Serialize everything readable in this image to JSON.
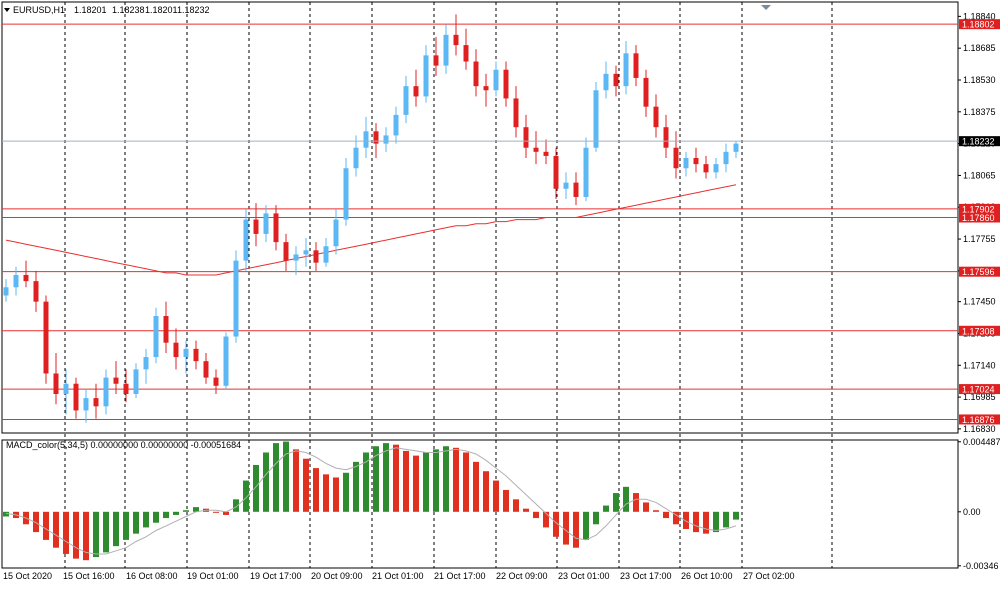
{
  "chart_data": {
    "type": "candlestick",
    "symbol_label": "EURUSD,H1",
    "ohlc_readout": [
      "1.18201",
      "1.18238",
      "1.18201",
      "1.18232"
    ],
    "current_price": "1.18232",
    "y_ticks": [
      "1.18840",
      "1.18685",
      "1.18530",
      "1.18375",
      "1.18220",
      "1.18065",
      "1.17910",
      "1.17755",
      "1.17600",
      "1.17450",
      "1.17295",
      "1.17140",
      "1.16985",
      "1.16830"
    ],
    "ylim": [
      1.1681,
      1.1891
    ],
    "grid": "vertical dashed at session boundaries",
    "x_ticks": [
      "15 Oct 2020",
      "15 Oct 16:00",
      "16 Oct 08:00",
      "19 Oct 01:00",
      "19 Oct 17:00",
      "20 Oct 09:00",
      "21 Oct 01:00",
      "21 Oct 17:00",
      "22 Oct 09:00",
      "23 Oct 01:00",
      "23 Oct 17:00",
      "26 Oct 10:00",
      "27 Oct 02:00"
    ],
    "horizontal_levels": [
      "1.18802",
      "1.17902",
      "1.17860",
      "1.17596",
      "1.17308",
      "1.17024",
      "1.16876"
    ],
    "candles": [
      [
        1.1748,
        1.1756,
        1.1745,
        1.1752
      ],
      [
        1.1752,
        1.1762,
        1.1748,
        1.1758
      ],
      [
        1.1758,
        1.1765,
        1.1752,
        1.1755
      ],
      [
        1.1755,
        1.176,
        1.174,
        1.1745
      ],
      [
        1.1745,
        1.1748,
        1.1705,
        1.171
      ],
      [
        1.171,
        1.172,
        1.1695,
        1.17
      ],
      [
        1.17,
        1.1712,
        1.169,
        1.1705
      ],
      [
        1.1705,
        1.1708,
        1.1688,
        1.1692
      ],
      [
        1.1692,
        1.1702,
        1.1686,
        1.1698
      ],
      [
        1.1698,
        1.1705,
        1.1688,
        1.1694
      ],
      [
        1.1694,
        1.1712,
        1.169,
        1.1708
      ],
      [
        1.1708,
        1.1716,
        1.17,
        1.1705
      ],
      [
        1.1705,
        1.1712,
        1.1696,
        1.17
      ],
      [
        1.17,
        1.1715,
        1.1698,
        1.1712
      ],
      [
        1.1712,
        1.1722,
        1.1705,
        1.1718
      ],
      [
        1.1718,
        1.1742,
        1.1715,
        1.1738
      ],
      [
        1.1738,
        1.1745,
        1.172,
        1.1725
      ],
      [
        1.1725,
        1.1732,
        1.1712,
        1.1718
      ],
      [
        1.1718,
        1.1726,
        1.171,
        1.1722
      ],
      [
        1.1722,
        1.1726,
        1.1712,
        1.1716
      ],
      [
        1.1716,
        1.172,
        1.1705,
        1.1708
      ],
      [
        1.1708,
        1.1712,
        1.17,
        1.1704
      ],
      [
        1.1704,
        1.173,
        1.1702,
        1.1728
      ],
      [
        1.1728,
        1.177,
        1.1725,
        1.1765
      ],
      [
        1.1765,
        1.179,
        1.176,
        1.1785
      ],
      [
        1.1785,
        1.1793,
        1.1772,
        1.1778
      ],
      [
        1.1778,
        1.1792,
        1.1774,
        1.1788
      ],
      [
        1.1788,
        1.1792,
        1.177,
        1.1774
      ],
      [
        1.1774,
        1.1778,
        1.176,
        1.1765
      ],
      [
        1.1765,
        1.1772,
        1.1758,
        1.1768
      ],
      [
        1.1768,
        1.1776,
        1.1762,
        1.177
      ],
      [
        1.177,
        1.1774,
        1.176,
        1.1764
      ],
      [
        1.1764,
        1.1776,
        1.1762,
        1.1772
      ],
      [
        1.1772,
        1.179,
        1.1768,
        1.1785
      ],
      [
        1.1785,
        1.1815,
        1.1782,
        1.181
      ],
      [
        1.181,
        1.1826,
        1.1806,
        1.182
      ],
      [
        1.182,
        1.1835,
        1.1815,
        1.1828
      ],
      [
        1.1828,
        1.1832,
        1.1815,
        1.1822
      ],
      [
        1.1822,
        1.183,
        1.1818,
        1.1826
      ],
      [
        1.1826,
        1.184,
        1.1822,
        1.1836
      ],
      [
        1.1836,
        1.1855,
        1.1832,
        1.185
      ],
      [
        1.185,
        1.1858,
        1.184,
        1.1845
      ],
      [
        1.1845,
        1.187,
        1.1842,
        1.1865
      ],
      [
        1.1865,
        1.1874,
        1.1855,
        1.186
      ],
      [
        1.186,
        1.188,
        1.1856,
        1.1875
      ],
      [
        1.1875,
        1.1885,
        1.1865,
        1.187
      ],
      [
        1.187,
        1.1878,
        1.1858,
        1.1862
      ],
      [
        1.1862,
        1.1868,
        1.1845,
        1.185
      ],
      [
        1.185,
        1.1856,
        1.184,
        1.1848
      ],
      [
        1.1848,
        1.1862,
        1.1845,
        1.1858
      ],
      [
        1.1858,
        1.1862,
        1.184,
        1.1844
      ],
      [
        1.1844,
        1.185,
        1.1825,
        1.183
      ],
      [
        1.183,
        1.1836,
        1.1815,
        1.182
      ],
      [
        1.182,
        1.1828,
        1.1812,
        1.1818
      ],
      [
        1.1818,
        1.1824,
        1.1812,
        1.1816
      ],
      [
        1.1816,
        1.182,
        1.1795,
        1.18
      ],
      [
        1.18,
        1.1808,
        1.1795,
        1.1803
      ],
      [
        1.1803,
        1.1808,
        1.1792,
        1.1796
      ],
      [
        1.1796,
        1.1825,
        1.1794,
        1.182
      ],
      [
        1.182,
        1.1852,
        1.1818,
        1.1848
      ],
      [
        1.1848,
        1.1862,
        1.1844,
        1.1856
      ],
      [
        1.1856,
        1.186,
        1.1845,
        1.185
      ],
      [
        1.185,
        1.1872,
        1.1846,
        1.1866
      ],
      [
        1.1866,
        1.187,
        1.185,
        1.1854
      ],
      [
        1.1854,
        1.1858,
        1.1835,
        1.184
      ],
      [
        1.184,
        1.1846,
        1.1825,
        1.183
      ],
      [
        1.183,
        1.1836,
        1.1815,
        1.182
      ],
      [
        1.182,
        1.1828,
        1.1805,
        1.181
      ],
      [
        1.181,
        1.1818,
        1.1806,
        1.1815
      ],
      [
        1.1815,
        1.182,
        1.1808,
        1.1812
      ],
      [
        1.1812,
        1.1816,
        1.1805,
        1.1808
      ],
      [
        1.1808,
        1.1815,
        1.1805,
        1.1812
      ],
      [
        1.1812,
        1.1822,
        1.1808,
        1.1818
      ],
      [
        1.1818,
        1.1823,
        1.1815,
        1.1822
      ]
    ],
    "ma_line": [
      1.1775,
      1.1774,
      1.1773,
      1.1772,
      1.1771,
      1.177,
      1.1769,
      1.1768,
      1.1767,
      1.1766,
      1.1765,
      1.1764,
      1.1763,
      1.1762,
      1.1761,
      1.176,
      1.1759,
      1.1759,
      1.1758,
      1.1758,
      1.1758,
      1.1758,
      1.1759,
      1.176,
      1.1761,
      1.1762,
      1.1763,
      1.1764,
      1.1765,
      1.1766,
      1.1767,
      1.1768,
      1.1769,
      1.177,
      1.1771,
      1.1772,
      1.1773,
      1.1774,
      1.1775,
      1.1776,
      1.1777,
      1.1778,
      1.1779,
      1.178,
      1.1781,
      1.1782,
      1.1782,
      1.1783,
      1.1783,
      1.1784,
      1.1784,
      1.1785,
      1.1785,
      1.1785,
      1.1786,
      1.1786,
      1.1786,
      1.1786,
      1.1787,
      1.1788,
      1.1789,
      1.179,
      1.1791,
      1.1792,
      1.1793,
      1.1794,
      1.1795,
      1.1796,
      1.1797,
      1.1798,
      1.1799,
      1.18,
      1.1801,
      1.1802
    ],
    "macd": {
      "label": "MACD_color(5,34,5) 0.00000000 0.00000000 -0.00051684",
      "y_ticks": [
        "0.004487",
        "0.00",
        "-0.00346"
      ],
      "ylim": [
        -0.0036,
        0.0046
      ],
      "histogram": [
        -0.0003,
        -0.0004,
        -0.0008,
        -0.0013,
        -0.0018,
        -0.0023,
        -0.0027,
        -0.003,
        -0.0031,
        -0.0029,
        -0.0026,
        -0.0022,
        -0.0018,
        -0.0014,
        -0.001,
        -0.0007,
        -0.0004,
        -0.0002,
        0.0001,
        0.0003,
        0.0002,
        0.0,
        -0.0002,
        0.0008,
        0.002,
        0.003,
        0.0038,
        0.0044,
        0.0045,
        0.004,
        0.0034,
        0.0028,
        0.0024,
        0.0022,
        0.0025,
        0.0032,
        0.0038,
        0.0042,
        0.0044,
        0.0043,
        0.0039,
        0.0036,
        0.0038,
        0.004,
        0.0042,
        0.0041,
        0.0038,
        0.0032,
        0.0026,
        0.002,
        0.0014,
        0.0008,
        0.0002,
        -0.0004,
        -0.001,
        -0.0016,
        -0.0021,
        -0.0023,
        -0.0018,
        -0.0008,
        0.0004,
        0.0012,
        0.0016,
        0.0012,
        0.0006,
        0.0001,
        -0.0004,
        -0.0008,
        -0.0011,
        -0.0013,
        -0.0014,
        -0.0013,
        -0.001,
        -0.0005
      ],
      "signal_line": [
        -0.0001,
        -0.0002,
        -0.0004,
        -0.0007,
        -0.0011,
        -0.0015,
        -0.0019,
        -0.0023,
        -0.0026,
        -0.0027,
        -0.0027,
        -0.0025,
        -0.0023,
        -0.0019,
        -0.0016,
        -0.0012,
        -0.0009,
        -0.0006,
        -0.0003,
        0.0,
        0.0001,
        0.0001,
        0.0,
        0.0003,
        0.0009,
        0.0016,
        0.0024,
        0.0031,
        0.0037,
        0.0039,
        0.0038,
        0.0035,
        0.0031,
        0.0028,
        0.0027,
        0.0029,
        0.0032,
        0.0036,
        0.0039,
        0.0041,
        0.004,
        0.0039,
        0.0038,
        0.0038,
        0.0039,
        0.004,
        0.0039,
        0.0037,
        0.0033,
        0.0028,
        0.0023,
        0.0017,
        0.0011,
        0.0005,
        -0.0001,
        -0.0007,
        -0.0012,
        -0.0017,
        -0.0018,
        -0.0015,
        -0.0009,
        -0.0002,
        0.0005,
        0.0008,
        0.0008,
        0.0006,
        0.0002,
        -0.0002,
        -0.0006,
        -0.0009,
        -0.0011,
        -0.0012,
        -0.0011,
        -0.0009
      ]
    },
    "colors": {
      "bull": "#5bb8f5",
      "bear": "#e02020",
      "level": "#e83030",
      "ma": "#e83030",
      "grid": "#000000",
      "current_line": "#a0b0c0",
      "hist_up": "#2e8b2e",
      "hist_down": "#e03020",
      "signal": "#b0b0b0",
      "tag_bg": "#e02020",
      "current_tag_bg": "#000000",
      "collapse_arrow": "#7a8aa0"
    }
  }
}
